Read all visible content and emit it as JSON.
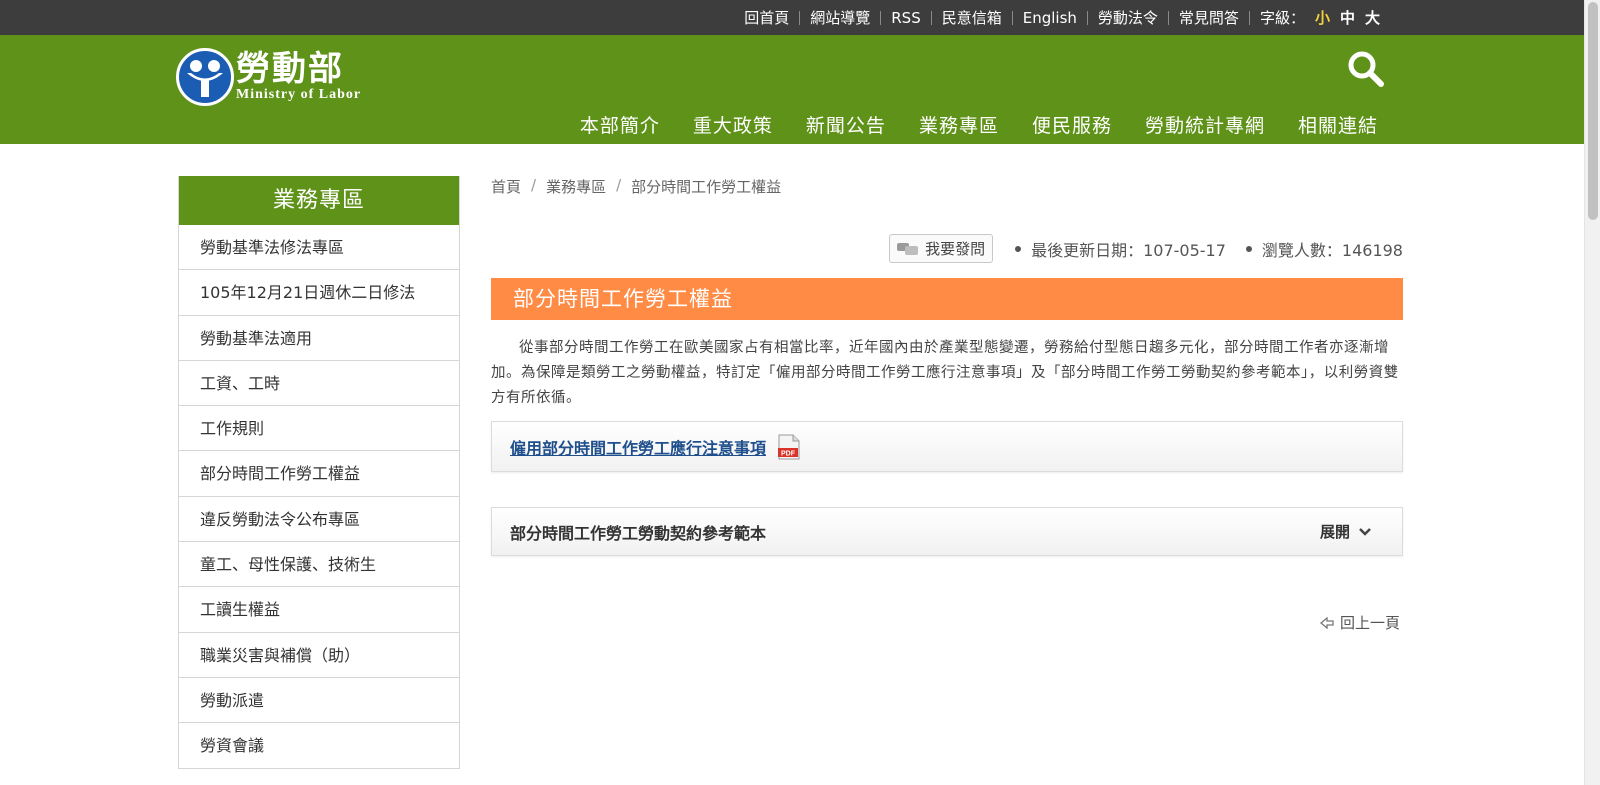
{
  "topbar": {
    "links": [
      "回首頁",
      "網站導覽",
      "RSS",
      "民意信箱",
      "English",
      "勞動法令",
      "常見問答"
    ],
    "font_size_label": "字級：",
    "font_sizes": [
      "小",
      "中",
      "大"
    ]
  },
  "header": {
    "logo_cn": "勞動部",
    "logo_en": "Ministry  of  Labor",
    "nav": [
      "本部簡介",
      "重大政策",
      "新聞公告",
      "業務專區",
      "便民服務",
      "勞動統計專網",
      "相關連結"
    ]
  },
  "sidebar": {
    "title": "業務專區",
    "items": [
      "勞動基準法修法專區",
      "105年12月21日週休二日修法",
      "勞動基準法適用",
      "工資、工時",
      "工作規則",
      "部分時間工作勞工權益",
      "違反勞動法令公布專區",
      "童工、母性保護、技術生",
      "工讀生權益",
      "職業災害與補償（助）",
      "勞動派遣",
      "勞資會議"
    ]
  },
  "breadcrumb": [
    "首頁",
    "業務專區",
    "部分時間工作勞工權益"
  ],
  "meta": {
    "ask_label": "我要發問",
    "updated": "最後更新日期：107-05-17",
    "views": "瀏覽人數：146198"
  },
  "main": {
    "title": "部分時間工作勞工權益",
    "intro": "從事部分時間工作勞工在歐美國家占有相當比率，近年國內由於產業型態變遷，勞務給付型態日趨多元化，部分時間工作者亦逐漸增加。為保障是類勞工之勞動權益，特訂定「僱用部分時間工作勞工應行注意事項」及「部分時間工作勞工勞動契約參考範本」，以利勞資雙方有所依循。",
    "doc_link": "僱用部分時間工作勞工應行注意事項",
    "accordion_title": "部分時間工作勞工勞動契約參考範本",
    "accordion_toggle": "展開",
    "back": "回上一頁"
  },
  "colors": {
    "header_green": "#5f9219",
    "title_orange": "#ff8b45",
    "topbar_dark": "#3d3d3d",
    "active_font_size": "#f4d23c"
  }
}
